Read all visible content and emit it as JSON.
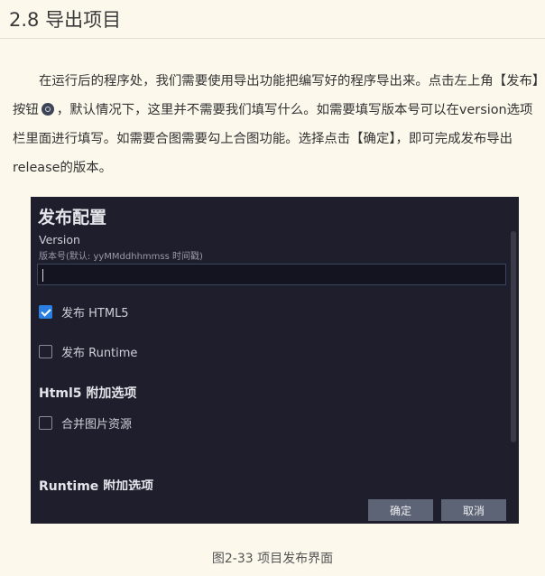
{
  "section": {
    "number_title": "2.8 导出项目"
  },
  "paragraph": {
    "part1": "在运行后的程序处，我们需要使用导出功能把编写好的程序导出来。点击左上角【发布】按钮",
    "part2": "，默认情况下，这里并不需要我们填写什么。如需要填写版本号可以在version选项栏里面进行填写。如需要合图需要勾上合图功能。选择点击【确定】，即可完成发布导出release的版本。",
    "inline_icon": "publish-icon"
  },
  "dialog": {
    "title": "发布配置",
    "version_label": "Version",
    "version_hint": "版本号(默认: yyMMddhhmmss 时间戳)",
    "version_value": "",
    "publish_html5": {
      "label": "发布 HTML5",
      "checked": true
    },
    "publish_runtime": {
      "label": "发布 Runtime",
      "checked": false
    },
    "html5_options_title": "Html5 附加选项",
    "merge_images": {
      "label": "合并图片资源",
      "checked": false
    },
    "runtime_options_title": "Runtime 附加选项",
    "ok_label": "确定",
    "cancel_label": "取消",
    "colors": {
      "background": "#1e1e2c",
      "checkbox_checked": "#2b7fe0",
      "button": "#5d6475"
    }
  },
  "figure_caption": "图2-33 项目发布界面"
}
